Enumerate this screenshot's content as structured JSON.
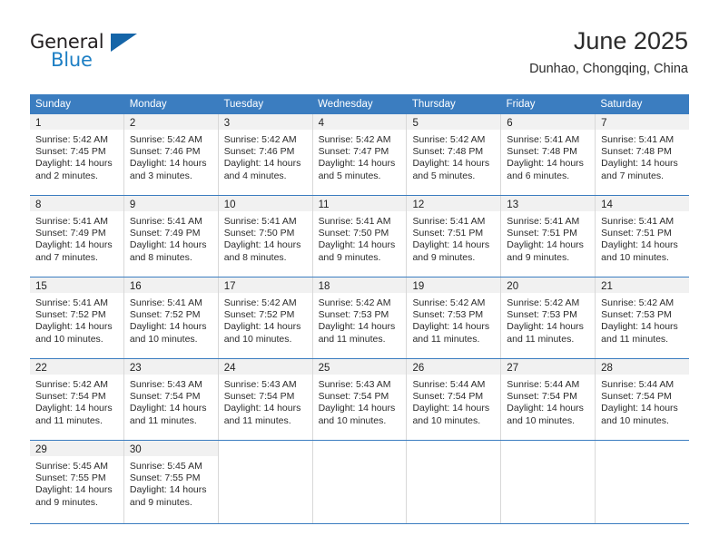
{
  "brand": {
    "word1": "General",
    "word2": "Blue",
    "triangle_color": "#1565a8",
    "blue_color": "#1d7fc4"
  },
  "header": {
    "title": "June 2025",
    "location": "Dunhao, Chongqing, China"
  },
  "theme": {
    "header_row_bg": "#3b7dc0",
    "daynum_band_bg": "#f1f1f1",
    "cell_border": "#d8d8d8",
    "text": "#2b2b2b"
  },
  "weekdays": [
    "Sunday",
    "Monday",
    "Tuesday",
    "Wednesday",
    "Thursday",
    "Friday",
    "Saturday"
  ],
  "weeks": [
    [
      {
        "day": "1",
        "sunrise": "Sunrise: 5:42 AM",
        "sunset": "Sunset: 7:45 PM",
        "daylight1": "Daylight: 14 hours",
        "daylight2": "and 2 minutes."
      },
      {
        "day": "2",
        "sunrise": "Sunrise: 5:42 AM",
        "sunset": "Sunset: 7:46 PM",
        "daylight1": "Daylight: 14 hours",
        "daylight2": "and 3 minutes."
      },
      {
        "day": "3",
        "sunrise": "Sunrise: 5:42 AM",
        "sunset": "Sunset: 7:46 PM",
        "daylight1": "Daylight: 14 hours",
        "daylight2": "and 4 minutes."
      },
      {
        "day": "4",
        "sunrise": "Sunrise: 5:42 AM",
        "sunset": "Sunset: 7:47 PM",
        "daylight1": "Daylight: 14 hours",
        "daylight2": "and 5 minutes."
      },
      {
        "day": "5",
        "sunrise": "Sunrise: 5:42 AM",
        "sunset": "Sunset: 7:48 PM",
        "daylight1": "Daylight: 14 hours",
        "daylight2": "and 5 minutes."
      },
      {
        "day": "6",
        "sunrise": "Sunrise: 5:41 AM",
        "sunset": "Sunset: 7:48 PM",
        "daylight1": "Daylight: 14 hours",
        "daylight2": "and 6 minutes."
      },
      {
        "day": "7",
        "sunrise": "Sunrise: 5:41 AM",
        "sunset": "Sunset: 7:48 PM",
        "daylight1": "Daylight: 14 hours",
        "daylight2": "and 7 minutes."
      }
    ],
    [
      {
        "day": "8",
        "sunrise": "Sunrise: 5:41 AM",
        "sunset": "Sunset: 7:49 PM",
        "daylight1": "Daylight: 14 hours",
        "daylight2": "and 7 minutes."
      },
      {
        "day": "9",
        "sunrise": "Sunrise: 5:41 AM",
        "sunset": "Sunset: 7:49 PM",
        "daylight1": "Daylight: 14 hours",
        "daylight2": "and 8 minutes."
      },
      {
        "day": "10",
        "sunrise": "Sunrise: 5:41 AM",
        "sunset": "Sunset: 7:50 PM",
        "daylight1": "Daylight: 14 hours",
        "daylight2": "and 8 minutes."
      },
      {
        "day": "11",
        "sunrise": "Sunrise: 5:41 AM",
        "sunset": "Sunset: 7:50 PM",
        "daylight1": "Daylight: 14 hours",
        "daylight2": "and 9 minutes."
      },
      {
        "day": "12",
        "sunrise": "Sunrise: 5:41 AM",
        "sunset": "Sunset: 7:51 PM",
        "daylight1": "Daylight: 14 hours",
        "daylight2": "and 9 minutes."
      },
      {
        "day": "13",
        "sunrise": "Sunrise: 5:41 AM",
        "sunset": "Sunset: 7:51 PM",
        "daylight1": "Daylight: 14 hours",
        "daylight2": "and 9 minutes."
      },
      {
        "day": "14",
        "sunrise": "Sunrise: 5:41 AM",
        "sunset": "Sunset: 7:51 PM",
        "daylight1": "Daylight: 14 hours",
        "daylight2": "and 10 minutes."
      }
    ],
    [
      {
        "day": "15",
        "sunrise": "Sunrise: 5:41 AM",
        "sunset": "Sunset: 7:52 PM",
        "daylight1": "Daylight: 14 hours",
        "daylight2": "and 10 minutes."
      },
      {
        "day": "16",
        "sunrise": "Sunrise: 5:41 AM",
        "sunset": "Sunset: 7:52 PM",
        "daylight1": "Daylight: 14 hours",
        "daylight2": "and 10 minutes."
      },
      {
        "day": "17",
        "sunrise": "Sunrise: 5:42 AM",
        "sunset": "Sunset: 7:52 PM",
        "daylight1": "Daylight: 14 hours",
        "daylight2": "and 10 minutes."
      },
      {
        "day": "18",
        "sunrise": "Sunrise: 5:42 AM",
        "sunset": "Sunset: 7:53 PM",
        "daylight1": "Daylight: 14 hours",
        "daylight2": "and 11 minutes."
      },
      {
        "day": "19",
        "sunrise": "Sunrise: 5:42 AM",
        "sunset": "Sunset: 7:53 PM",
        "daylight1": "Daylight: 14 hours",
        "daylight2": "and 11 minutes."
      },
      {
        "day": "20",
        "sunrise": "Sunrise: 5:42 AM",
        "sunset": "Sunset: 7:53 PM",
        "daylight1": "Daylight: 14 hours",
        "daylight2": "and 11 minutes."
      },
      {
        "day": "21",
        "sunrise": "Sunrise: 5:42 AM",
        "sunset": "Sunset: 7:53 PM",
        "daylight1": "Daylight: 14 hours",
        "daylight2": "and 11 minutes."
      }
    ],
    [
      {
        "day": "22",
        "sunrise": "Sunrise: 5:42 AM",
        "sunset": "Sunset: 7:54 PM",
        "daylight1": "Daylight: 14 hours",
        "daylight2": "and 11 minutes."
      },
      {
        "day": "23",
        "sunrise": "Sunrise: 5:43 AM",
        "sunset": "Sunset: 7:54 PM",
        "daylight1": "Daylight: 14 hours",
        "daylight2": "and 11 minutes."
      },
      {
        "day": "24",
        "sunrise": "Sunrise: 5:43 AM",
        "sunset": "Sunset: 7:54 PM",
        "daylight1": "Daylight: 14 hours",
        "daylight2": "and 11 minutes."
      },
      {
        "day": "25",
        "sunrise": "Sunrise: 5:43 AM",
        "sunset": "Sunset: 7:54 PM",
        "daylight1": "Daylight: 14 hours",
        "daylight2": "and 10 minutes."
      },
      {
        "day": "26",
        "sunrise": "Sunrise: 5:44 AM",
        "sunset": "Sunset: 7:54 PM",
        "daylight1": "Daylight: 14 hours",
        "daylight2": "and 10 minutes."
      },
      {
        "day": "27",
        "sunrise": "Sunrise: 5:44 AM",
        "sunset": "Sunset: 7:54 PM",
        "daylight1": "Daylight: 14 hours",
        "daylight2": "and 10 minutes."
      },
      {
        "day": "28",
        "sunrise": "Sunrise: 5:44 AM",
        "sunset": "Sunset: 7:54 PM",
        "daylight1": "Daylight: 14 hours",
        "daylight2": "and 10 minutes."
      }
    ],
    [
      {
        "day": "29",
        "sunrise": "Sunrise: 5:45 AM",
        "sunset": "Sunset: 7:55 PM",
        "daylight1": "Daylight: 14 hours",
        "daylight2": "and 9 minutes."
      },
      {
        "day": "30",
        "sunrise": "Sunrise: 5:45 AM",
        "sunset": "Sunset: 7:55 PM",
        "daylight1": "Daylight: 14 hours",
        "daylight2": "and 9 minutes."
      },
      {
        "day": "",
        "sunrise": "",
        "sunset": "",
        "daylight1": "",
        "daylight2": ""
      },
      {
        "day": "",
        "sunrise": "",
        "sunset": "",
        "daylight1": "",
        "daylight2": ""
      },
      {
        "day": "",
        "sunrise": "",
        "sunset": "",
        "daylight1": "",
        "daylight2": ""
      },
      {
        "day": "",
        "sunrise": "",
        "sunset": "",
        "daylight1": "",
        "daylight2": ""
      },
      {
        "day": "",
        "sunrise": "",
        "sunset": "",
        "daylight1": "",
        "daylight2": ""
      }
    ]
  ]
}
